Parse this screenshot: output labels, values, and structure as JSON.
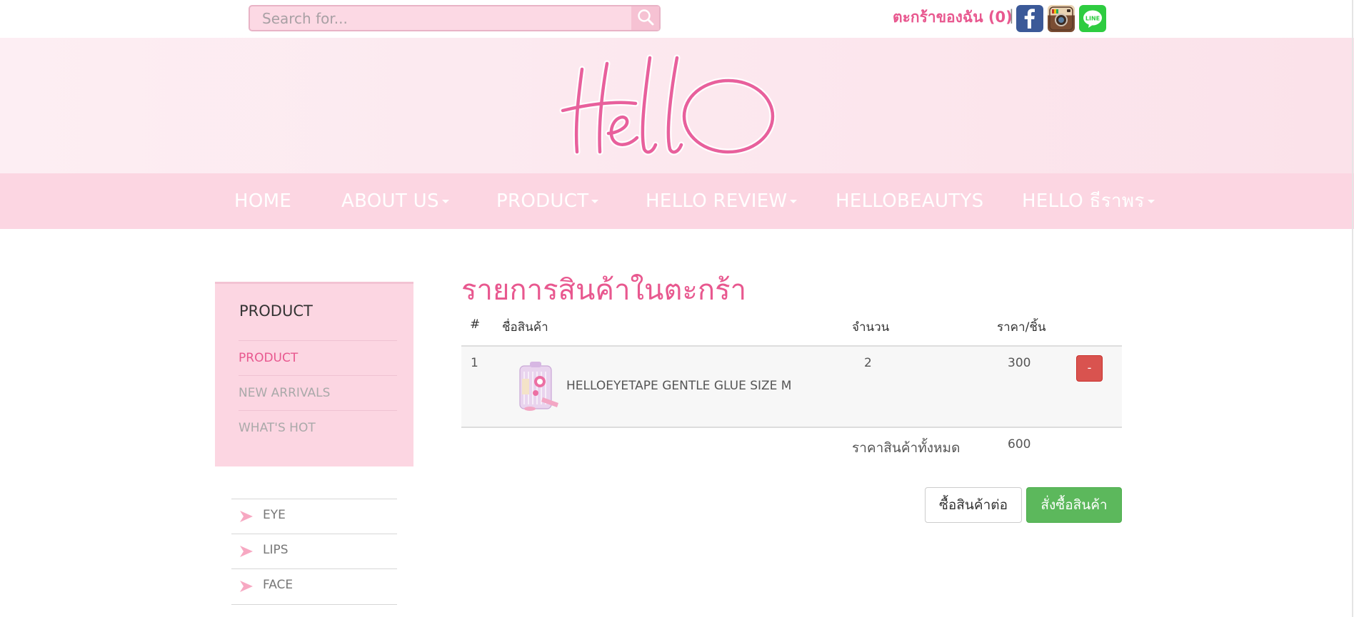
{
  "search": {
    "placeholder": "Search for..."
  },
  "cart_link": "ตะกร้าของฉัน (0)",
  "separator": "|",
  "social": [
    "facebook-icon",
    "instagram-icon",
    "line-icon"
  ],
  "logo_text": "Hello",
  "nav": {
    "items": [
      {
        "label": "HOME",
        "dropdown": false
      },
      {
        "label": "ABOUT US",
        "dropdown": true
      },
      {
        "label": "PRODUCT",
        "dropdown": true
      },
      {
        "label": "HELLO REVIEW",
        "dropdown": true
      },
      {
        "label": "HELLOBEAUTYS",
        "dropdown": false
      },
      {
        "label": "HELLO ธีราพร",
        "dropdown": true
      }
    ]
  },
  "sidebar": {
    "title": "PRODUCT",
    "items": [
      {
        "label": "PRODUCT",
        "active": true
      },
      {
        "label": "NEW ARRIVALS",
        "active": false
      },
      {
        "label": "WHAT'S HOT",
        "active": false
      }
    ],
    "categories": [
      {
        "label": "EYE"
      },
      {
        "label": "LIPS"
      },
      {
        "label": "FACE"
      }
    ]
  },
  "cart": {
    "title": "รายการสินค้าในตะกร้า",
    "headers": {
      "num": "#",
      "name": "ชื่อสินค้า",
      "qty": "จำนวน",
      "price": "ราคา/ชิ้น"
    },
    "rows": [
      {
        "num": "1",
        "name": "HELLOEYETAPE GENTLE GLUE SIZE M",
        "qty": "2",
        "price": "300",
        "remove_label": "-"
      }
    ],
    "total_label": "ราคาสินค้าทั้งหมด",
    "total_value": "600",
    "continue_label": "ซื้อสินค้าต่อ",
    "order_label": "สั่งซื้อสินค้า"
  },
  "colors": {
    "accent": "#e8588f",
    "nav_bg": "#fcd6e2",
    "banner_bg": "#fbe2ea",
    "remove_btn": "#d9534f",
    "order_btn": "#5cb85c"
  }
}
